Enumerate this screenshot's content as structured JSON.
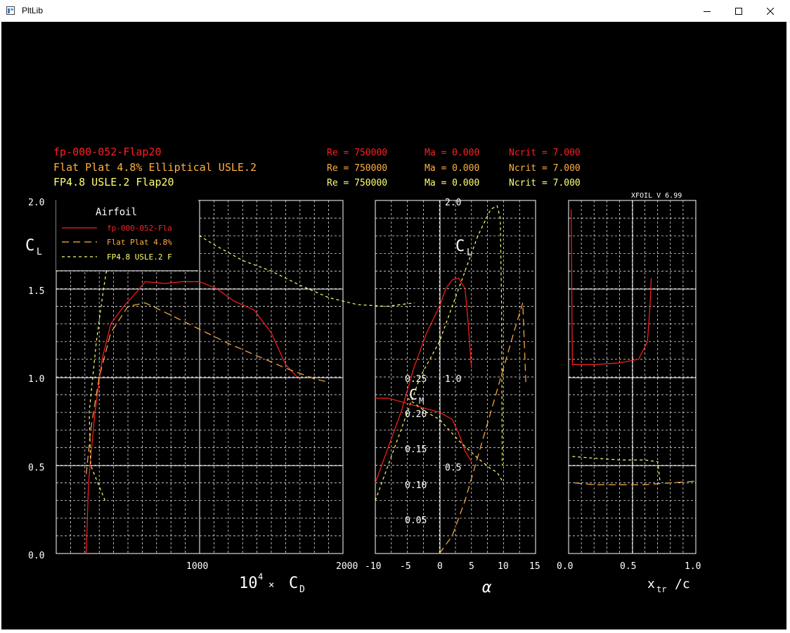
{
  "window": {
    "title": "PltLib",
    "icon": "window-app-icon"
  },
  "controls": {
    "minimize": "minimize-icon",
    "maximize": "maximize-icon",
    "close": "close-icon"
  },
  "plot": {
    "colors": {
      "background": "#000000",
      "grid": "#ffffff",
      "series1": "#ff2020",
      "series2": "#ffb040",
      "series3": "#ffff70"
    },
    "header": [
      {
        "name": "fp-000-052-Flap20",
        "re": "Re = 750000",
        "ma": "Ma = 0.000",
        "ncrit": "Ncrit = 7.000",
        "color": "#ff2020"
      },
      {
        "name": "Flat Plat 4.8% Elliptical USLE.2",
        "re": "Re = 750000",
        "ma": "Ma = 0.000",
        "ncrit": "Ncrit = 7.000",
        "color": "#ffb040"
      },
      {
        "name": "FP4.8 USLE.2 Flap20",
        "re": "Re = 750000",
        "ma": "Ma = 0.000",
        "ncrit": "Ncrit = 7.000",
        "color": "#ffff70"
      }
    ],
    "version": "XFOIL V 6.99",
    "legend": {
      "title": "Airfoil",
      "items": [
        "fp-000-052-Fla",
        "Flat Plat 4.8%",
        "FP4.8 USLE.2 F"
      ]
    },
    "labels": {
      "cl_main": "C",
      "cl_main_sub": "L",
      "cl_alpha": "C",
      "cl_alpha_sub": "L",
      "cm": "C",
      "cm_sub": "M",
      "cd_prefix": "10",
      "cd_exp": "4",
      "cd_times": "×",
      "cd": "C",
      "cd_sub": "D",
      "alpha": "α",
      "xtr": "x",
      "xtr_sub": "tr",
      "xtr_suffix": "/c"
    },
    "polar_cd": {
      "x_ticks": [
        "1000",
        "2000"
      ],
      "y_ticks": [
        "0.0",
        "0.5",
        "1.0",
        "1.5",
        "2.0"
      ]
    },
    "polar_alpha": {
      "x_ticks": [
        "-10",
        "-5",
        "0",
        "5",
        "10",
        "15"
      ],
      "cl_ticks": [
        "0.5",
        "1.0",
        "2.0"
      ],
      "cm_ticks": [
        "0.05",
        "0.10",
        "0.15",
        "0.20",
        "0.25"
      ]
    },
    "polar_xtr": {
      "x_ticks": [
        "0.0",
        "0.5",
        "1.0"
      ]
    }
  },
  "chart_data": [
    {
      "type": "line",
      "xlabel": "10^4 x CD",
      "ylabel": "CL",
      "xlim": [
        0,
        2000
      ],
      "ylim": [
        0,
        2.0
      ],
      "series": [
        {
          "name": "fp-000-052-Fla",
          "points": [
            [
              210,
              0.0
            ],
            [
              225,
              0.4
            ],
            [
              270,
              0.8
            ],
            [
              320,
              1.1
            ],
            [
              380,
              1.3
            ],
            [
              470,
              1.4
            ],
            [
              560,
              1.48
            ],
            [
              620,
              1.54
            ],
            [
              760,
              1.53
            ],
            [
              880,
              1.54
            ],
            [
              1000,
              1.54
            ],
            [
              1120,
              1.5
            ],
            [
              1240,
              1.43
            ],
            [
              1380,
              1.38
            ],
            [
              1500,
              1.25
            ],
            [
              1600,
              1.07
            ],
            [
              1680,
              1.0
            ]
          ]
        },
        {
          "name": "Flat Plat 4.8%",
          "points": [
            [
              210,
              0.45
            ],
            [
              240,
              0.7
            ],
            [
              300,
              1.0
            ],
            [
              380,
              1.25
            ],
            [
              500,
              1.4
            ],
            [
              620,
              1.42
            ],
            [
              800,
              1.35
            ],
            [
              1000,
              1.27
            ],
            [
              1200,
              1.19
            ],
            [
              1400,
              1.12
            ],
            [
              1600,
              1.05
            ],
            [
              1800,
              0.99
            ],
            [
              1900,
              0.97
            ]
          ]
        },
        {
          "name": "FP4.8 USLE.2 F",
          "points": [
            [
              340,
              0.3
            ],
            [
              290,
              0.4
            ],
            [
              240,
              0.5
            ],
            [
              230,
              0.8
            ],
            [
              280,
              1.2
            ],
            [
              330,
              1.5
            ],
            [
              390,
              1.8
            ],
            [
              460,
              1.95
            ],
            [
              560,
              1.97
            ],
            [
              700,
              1.95
            ],
            [
              900,
              1.85
            ],
            [
              1100,
              1.75
            ],
            [
              1300,
              1.66
            ],
            [
              1500,
              1.6
            ],
            [
              1700,
              1.52
            ],
            [
              1900,
              1.45
            ],
            [
              2100,
              1.41
            ],
            [
              2300,
              1.4
            ],
            [
              2500,
              1.42
            ]
          ]
        }
      ]
    },
    {
      "type": "line",
      "xlabel": "alpha",
      "ylabel": "CL",
      "xlim": [
        -10,
        15
      ],
      "ylim": [
        0,
        2.0
      ],
      "series": [
        {
          "name": "fp-000-052-Fla",
          "points": [
            [
              -10,
              0.4
            ],
            [
              -8,
              0.6
            ],
            [
              -6,
              0.8
            ],
            [
              -4,
              1.05
            ],
            [
              -2,
              1.25
            ],
            [
              0,
              1.4
            ],
            [
              1,
              1.5
            ],
            [
              2,
              1.55
            ],
            [
              3,
              1.56
            ],
            [
              4,
              1.5
            ],
            [
              4.5,
              1.3
            ],
            [
              5,
              1.05
            ]
          ]
        },
        {
          "name": "Flat Plat 4.8%",
          "points": [
            [
              0,
              0.0
            ],
            [
              2,
              0.1
            ],
            [
              4,
              0.3
            ],
            [
              6,
              0.55
            ],
            [
              8,
              0.8
            ],
            [
              10,
              1.05
            ],
            [
              12,
              1.3
            ],
            [
              13,
              1.42
            ],
            [
              13.5,
              0.95
            ]
          ]
        },
        {
          "name": "FP4.8 USLE.2 F",
          "points": [
            [
              -10,
              0.3
            ],
            [
              -6,
              0.7
            ],
            [
              -3,
              1.0
            ],
            [
              0,
              1.2
            ],
            [
              2,
              1.4
            ],
            [
              4,
              1.6
            ],
            [
              6,
              1.8
            ],
            [
              8,
              1.95
            ],
            [
              9,
              1.97
            ],
            [
              9.5,
              1.9
            ],
            [
              9.7,
              1.4
            ],
            [
              9.8,
              0.5
            ]
          ]
        }
      ]
    },
    {
      "type": "line",
      "xlabel": "alpha",
      "ylabel": "CM",
      "xlim": [
        -10,
        15
      ],
      "ylim": [
        0,
        0.25
      ],
      "series": [
        {
          "name": "fp-000-052-Fla",
          "points": [
            [
              -10,
              0.22
            ],
            [
              -8,
              0.22
            ],
            [
              -6,
              0.215
            ],
            [
              -4,
              0.21
            ],
            [
              -2,
              0.205
            ],
            [
              0,
              0.2
            ],
            [
              2,
              0.19
            ],
            [
              3,
              0.17
            ],
            [
              4,
              0.145
            ],
            [
              5,
              0.13
            ]
          ]
        },
        {
          "name": "FP4.8 USLE.2 F",
          "points": [
            [
              -5,
              0.22
            ],
            [
              -2,
              0.2
            ],
            [
              0,
              0.19
            ],
            [
              3,
              0.16
            ],
            [
              6,
              0.135
            ],
            [
              8,
              0.12
            ],
            [
              9,
              0.115
            ],
            [
              10,
              0.1
            ]
          ]
        }
      ]
    },
    {
      "type": "line",
      "xlabel": "xtr/c",
      "ylabel": "CL",
      "xlim": [
        0,
        1.0
      ],
      "ylim": [
        0,
        2.0
      ],
      "series": [
        {
          "name": "fp-000-052-Fla upper",
          "points": [
            [
              0.02,
              1.95
            ],
            [
              0.03,
              1.07
            ],
            [
              0.2,
              1.07
            ],
            [
              0.4,
              1.08
            ],
            [
              0.55,
              1.1
            ],
            [
              0.62,
              1.2
            ],
            [
              0.64,
              1.4
            ],
            [
              0.65,
              1.56
            ]
          ]
        },
        {
          "name": "Flat Plat 4.8% lower",
          "points": [
            [
              0.05,
              0.4
            ],
            [
              0.2,
              0.39
            ],
            [
              0.4,
              0.39
            ],
            [
              0.6,
              0.39
            ],
            [
              0.8,
              0.4
            ],
            [
              1.0,
              0.41
            ]
          ]
        },
        {
          "name": "FP4.8 USLE.2 F",
          "points": [
            [
              0.03,
              0.55
            ],
            [
              0.2,
              0.54
            ],
            [
              0.4,
              0.53
            ],
            [
              0.6,
              0.53
            ],
            [
              0.7,
              0.52
            ],
            [
              0.72,
              0.4
            ]
          ]
        }
      ]
    }
  ]
}
